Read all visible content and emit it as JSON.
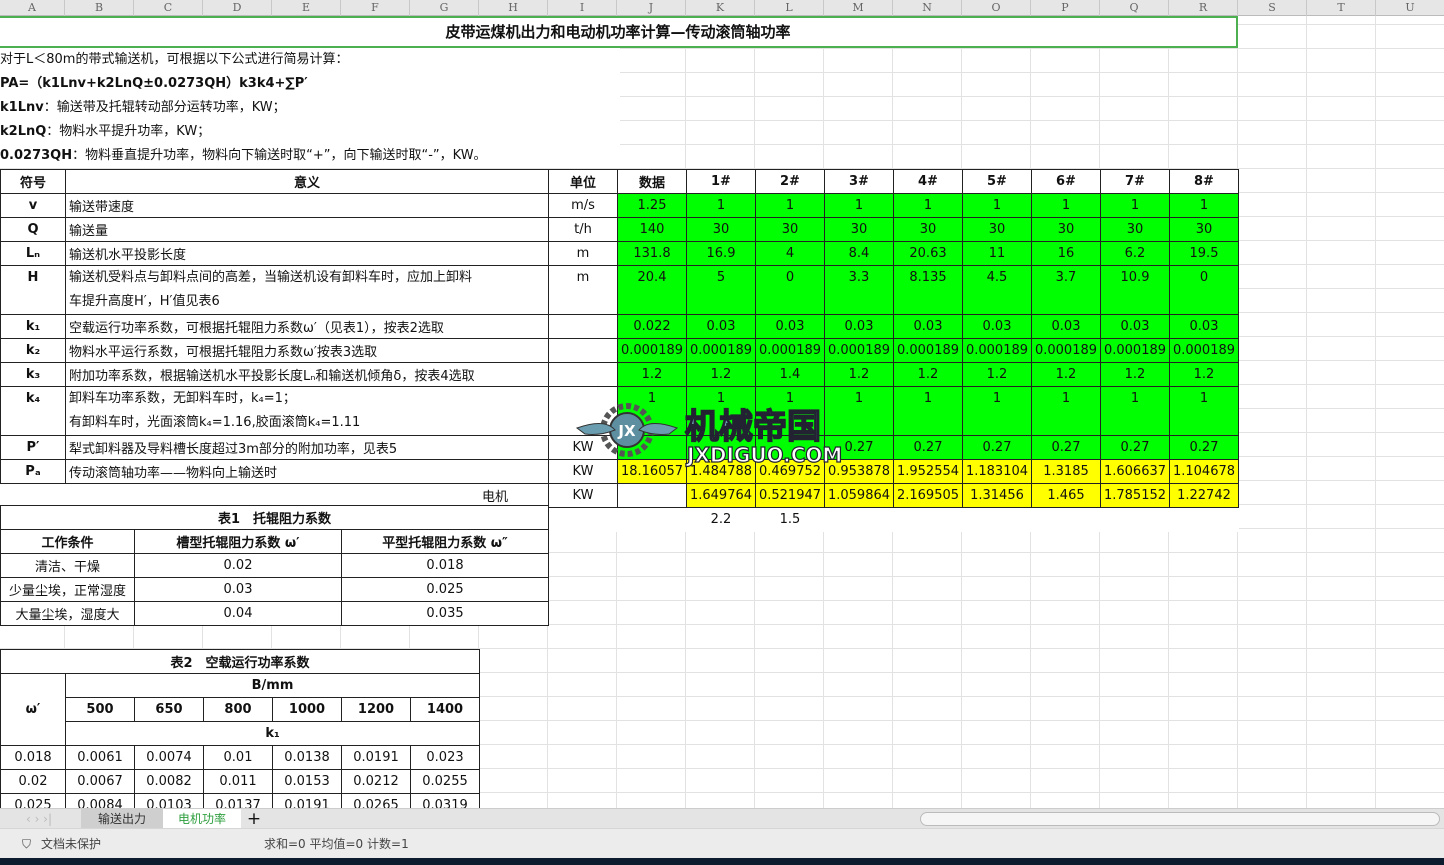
{
  "columns": [
    "A",
    "B",
    "C",
    "D",
    "E",
    "F",
    "G",
    "H",
    "I",
    "J",
    "K",
    "L",
    "M",
    "N",
    "O",
    "P",
    "Q",
    "R",
    "S",
    "T",
    "U"
  ],
  "title": "皮带运煤机出力和电动机功率计算—传动滚筒轴功率",
  "intro": [
    {
      "bold": "",
      "text": "对于L＜80m的带式输送机，可根据以下公式进行简易计算："
    },
    {
      "bold": "PA=（k1Lnv+k2LnQ±0.0273QH）k3k4+∑P′",
      "text": ""
    },
    {
      "bold": "k1Lnv",
      "text": "：输送带及托辊转动部分运转功率，KW；"
    },
    {
      "bold": "k2LnQ",
      "text": "：物料水平提升功率，KW；"
    },
    {
      "bold": "0.0273QH",
      "text": "：物料垂直提升功率，物料向下输送时取“+”，向下输送时取“-”，KW。"
    }
  ],
  "main_table": {
    "headers": [
      "符号",
      "意义",
      "单位",
      "数据",
      "1#",
      "2#",
      "3#",
      "4#",
      "5#",
      "6#",
      "7#",
      "8#"
    ],
    "rows": [
      {
        "sym": "v",
        "desc": "输送带速度",
        "unit": "m/s",
        "data": "1.25",
        "vals": [
          "1",
          "1",
          "1",
          "1",
          "1",
          "1",
          "1",
          "1"
        ]
      },
      {
        "sym": "Q",
        "desc": "输送量",
        "unit": "t/h",
        "data": "140",
        "vals": [
          "30",
          "30",
          "30",
          "30",
          "30",
          "30",
          "30",
          "30"
        ]
      },
      {
        "sym": "Lₙ",
        "desc": "输送机水平投影长度",
        "unit": "m",
        "data": "131.8",
        "vals": [
          "16.9",
          "4",
          "8.4",
          "20.63",
          "11",
          "16",
          "6.2",
          "19.5"
        ]
      },
      {
        "sym": "H",
        "desc": "输送机受料点与卸料点间的高差，当输送机设有卸料车时，应加上卸料",
        "desc2": "车提升高度H′，H′值见表6",
        "unit": "m",
        "data": "20.4",
        "vals": [
          "5",
          "0",
          "3.3",
          "8.135",
          "4.5",
          "3.7",
          "10.9",
          "0"
        ]
      },
      {
        "sym": "k₁",
        "desc": "空载运行功率系数，可根据托辊阻力系数ω′（见表1），按表2选取",
        "unit": "",
        "data": "0.022",
        "vals": [
          "0.03",
          "0.03",
          "0.03",
          "0.03",
          "0.03",
          "0.03",
          "0.03",
          "0.03"
        ]
      },
      {
        "sym": "k₂",
        "desc": "物料水平运行系数，可根据托辊阻力系数ω′按表3选取",
        "unit": "",
        "data": "0.000189",
        "vals": [
          "0.000189",
          "0.000189",
          "0.000189",
          "0.000189",
          "0.000189",
          "0.000189",
          "0.000189",
          "0.000189"
        ]
      },
      {
        "sym": "k₃",
        "desc": "附加功率系数，根据输送机水平投影长度Lₙ和输送机倾角δ，按表4选取",
        "unit": "",
        "data": "1.2",
        "vals": [
          "1.2",
          "1.4",
          "1.2",
          "1.2",
          "1.2",
          "1.2",
          "1.2",
          "1.2"
        ]
      },
      {
        "sym": "k₄",
        "desc": "卸料车功率系数，无卸料车时，k₄=1；",
        "desc2": "有卸料车时，光面滚筒k₄=1.16,胶面滚筒k₄=1.11",
        "unit": "",
        "data": "1",
        "vals": [
          "1",
          "1",
          "1",
          "1",
          "1",
          "1",
          "1",
          "1"
        ]
      },
      {
        "sym": "P′",
        "desc": "犁式卸料器及导料槽长度超过3m部分的附加功率，见表5",
        "unit": "KW",
        "data": "",
        "vals": [
          "",
          "",
          "0.27",
          "0.27",
          "0.27",
          "0.27",
          "0.27",
          "0.27"
        ]
      },
      {
        "sym": "Pₐ",
        "desc": "传动滚筒轴功率——物料向上输送时",
        "unit": "KW",
        "data": "18.16057",
        "vals": [
          "1.484788",
          "0.469752",
          "0.953878",
          "1.952554",
          "1.183104",
          "1.3185",
          "1.606637",
          "1.104678"
        ]
      }
    ],
    "motor": {
      "label": "电机",
      "unit": "KW",
      "vals": [
        "1.649764",
        "0.521947",
        "1.059864",
        "2.169505",
        "1.31456",
        "1.465",
        "1.785152",
        "1.22742"
      ]
    },
    "extra": [
      "2.2",
      "1.5"
    ]
  },
  "table1": {
    "title": "表1　托辊阻力系数",
    "headers": [
      "工作条件",
      "槽型托辊阻力系数 ω′",
      "平型托辊阻力系数 ω″"
    ],
    "rows": [
      [
        "清洁、干燥",
        "0.02",
        "0.018"
      ],
      [
        "少量尘埃，正常湿度",
        "0.03",
        "0.025"
      ],
      [
        "大量尘埃，湿度大",
        "0.04",
        "0.035"
      ]
    ]
  },
  "table2": {
    "title": "表2　空载运行功率系数",
    "omega": "ω′",
    "group": "B/mm",
    "widths": [
      "500",
      "650",
      "800",
      "1000",
      "1200",
      "1400"
    ],
    "sub": "k₁",
    "rows": [
      [
        "0.018",
        "0.0061",
        "0.0074",
        "0.01",
        "0.0138",
        "0.0191",
        "0.023"
      ],
      [
        "0.02",
        "0.0067",
        "0.0082",
        "0.011",
        "0.0153",
        "0.0212",
        "0.0255"
      ],
      [
        "0.025",
        "0.0084",
        "0.0103",
        "0.0137",
        "0.0191",
        "0.0265",
        "0.0319"
      ]
    ]
  },
  "watermark": {
    "text": "机械帝国",
    "url": "JXDIGUO.COM",
    "badge": "JX"
  },
  "sheets": {
    "tabs": [
      "输送出力",
      "电机功率"
    ],
    "active": 1,
    "add": "+"
  },
  "status": {
    "protect": "文档未保护",
    "stats": "求和=0  平均值=0  计数=1"
  },
  "colors": {
    "green": "#00ff00",
    "yellow": "#ffff00",
    "title_border": "#4caf50",
    "active_tab": "#2e9e3e"
  }
}
